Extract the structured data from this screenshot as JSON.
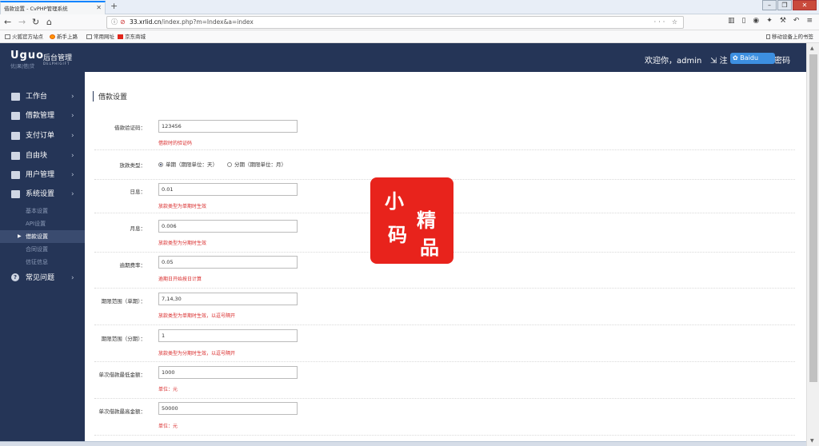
{
  "browser": {
    "tab_title": "借款设置 - CvPHP管理系统",
    "url_host": "33.xrlid.cn",
    "url_path": "/index.php?m=Index&a=index",
    "url_more": "··· ☆",
    "bookmarks": [
      "火狐官方站点",
      "新手上路",
      "常用网址",
      "京东商城"
    ],
    "mobile_bookmarks": "移动设备上的书签"
  },
  "header": {
    "logo_mark": "Uguo",
    "logo_sub": "优|果|借|贷",
    "title": "后台管理",
    "title_en": "DELPHIGIFT",
    "welcome": "欢迎你，admin",
    "logout": "注",
    "change_password": "密码",
    "baidu_overlay": "Baidu"
  },
  "sidebar": {
    "items": [
      {
        "label": "工作台",
        "icon": "monitor-icon"
      },
      {
        "label": "借款管理",
        "icon": "document-icon"
      },
      {
        "label": "支付订单",
        "icon": "card-icon"
      },
      {
        "label": "自由块",
        "icon": "grid-icon"
      },
      {
        "label": "用户管理",
        "icon": "user-icon"
      },
      {
        "label": "系统设置",
        "icon": "settings-icon"
      }
    ],
    "subitems": [
      "基本设置",
      "API设置",
      "借款设置",
      "合同设置",
      "信征信息"
    ],
    "help": "常见问题"
  },
  "page": {
    "title": "借款设置",
    "fields": [
      {
        "label": "借款验证码：",
        "value": "123456",
        "hint": "借款时的验证码"
      },
      {
        "label": "放款类型：",
        "type": "radio",
        "options": [
          "单期（期限单位：天）",
          "分期（期限单位：月）"
        ],
        "selected": 0
      },
      {
        "label": "日息：",
        "value": "0.01",
        "hint": "放款类型为单期时生效"
      },
      {
        "label": "月息：",
        "value": "0.006",
        "hint": "放款类型为分期时生效"
      },
      {
        "label": "逾期费率：",
        "value": "0.05",
        "hint": "逾期日开始按日计算"
      },
      {
        "label": "期限范围（单期）：",
        "value": "7,14,30",
        "hint": "放款类型为单期时生效，以逗号隔开"
      },
      {
        "label": "期限范围（分期）：",
        "value": "1",
        "hint": "放款类型为分期时生效，以逗号隔开"
      },
      {
        "label": "单次借款最低金额：",
        "value": "1000",
        "hint": "单位：元"
      },
      {
        "label": "单次借款最高金额：",
        "value": "50000",
        "hint": "单位：元"
      }
    ]
  },
  "watermark": {
    "chars": [
      "小",
      "精",
      "码",
      "品"
    ]
  },
  "colors": {
    "sidebar": "#253557",
    "accent": "#253557",
    "hint": "#d92a2a",
    "stamp": "#e8231c"
  }
}
